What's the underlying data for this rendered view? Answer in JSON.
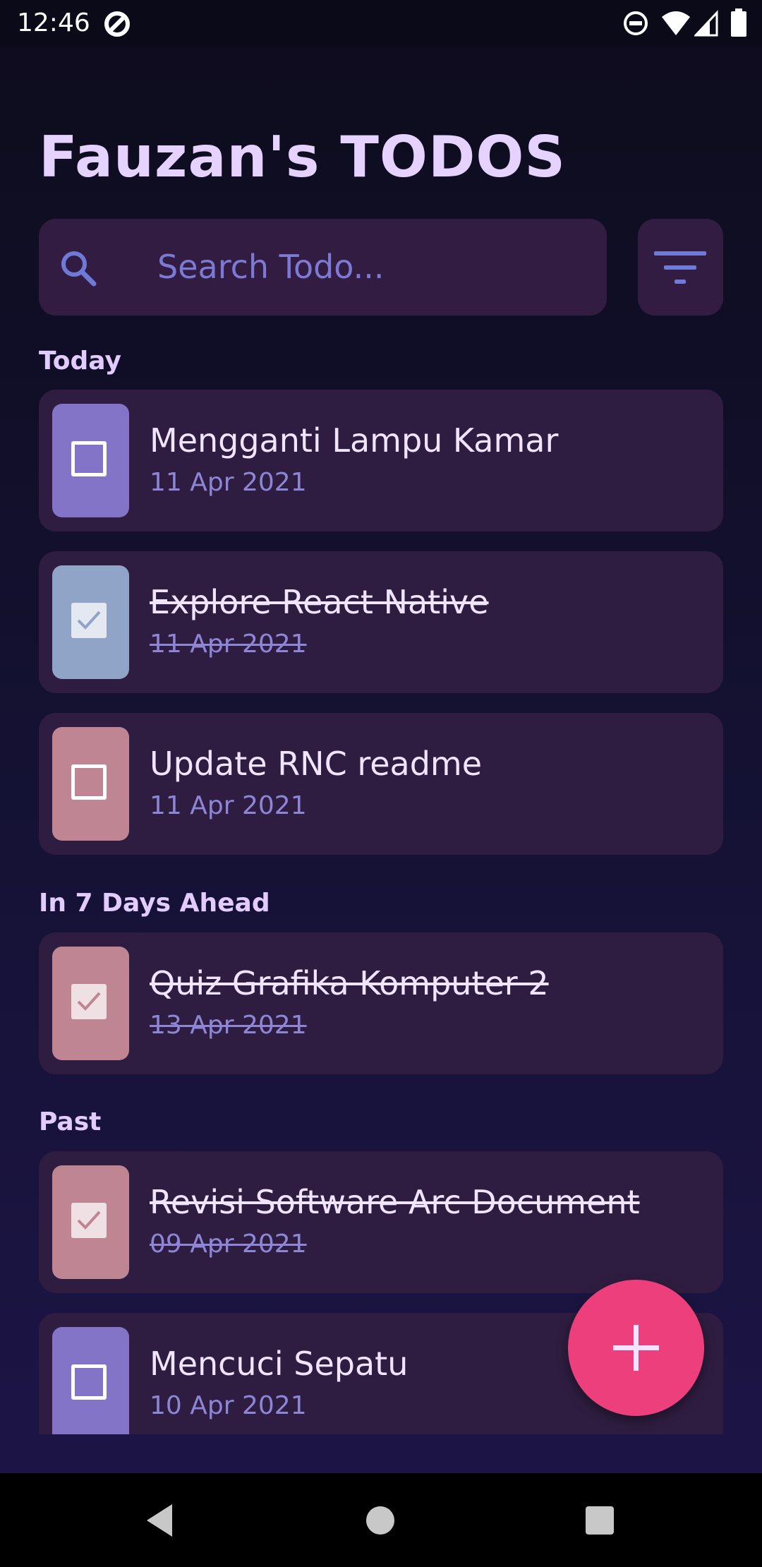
{
  "status_bar": {
    "time": "12:46"
  },
  "app": {
    "title": "Fauzan's TODOS"
  },
  "search": {
    "placeholder": "Search Todo..."
  },
  "sections": {
    "today": "Today",
    "ahead": "In 7 Days Ahead",
    "past": "Past"
  },
  "todos": [
    {
      "title": "Mengganti Lampu Kamar",
      "date": "11 Apr 2021",
      "done": false,
      "color": "#8374c8"
    },
    {
      "title": "Explore React Native",
      "date": "11 Apr 2021",
      "done": true,
      "color": "#8fa4c6"
    },
    {
      "title": "Update RNC readme",
      "date": "11 Apr 2021",
      "done": false,
      "color": "#c08592"
    },
    {
      "title": "Quiz Grafika Komputer 2",
      "date": "13 Apr 2021",
      "done": true,
      "color": "#c08592"
    },
    {
      "title": "Revisi Software Arc Document",
      "date": "09 Apr 2021",
      "done": true,
      "color": "#c08592"
    },
    {
      "title": "Mencuci Sepatu",
      "date": "10 Apr 2021",
      "done": false,
      "color": "#8374c8"
    }
  ],
  "icons": {
    "search": "search-icon",
    "filter": "filter-icon",
    "add": "plus-icon",
    "check": "check-icon"
  },
  "colors": {
    "accent": "#ec3f7c",
    "title": "#e6d2ff",
    "card": "#2e1d40"
  }
}
